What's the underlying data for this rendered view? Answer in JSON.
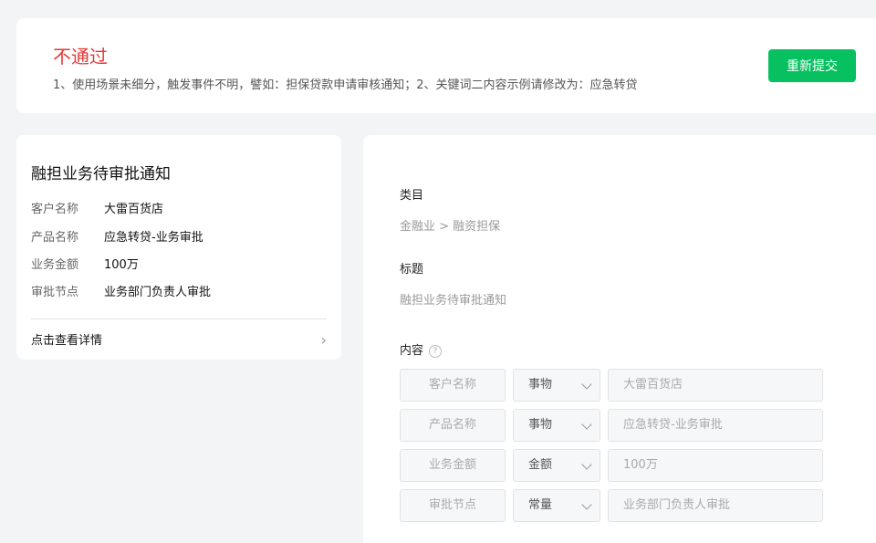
{
  "banner": {
    "status": "不通过",
    "message": "1、使用场景未细分，触发事件不明，譬如：担保贷款申请审核通知；2、关键词二内容示例请修改为：应急转贷",
    "resubmit_label": "重新提交"
  },
  "preview": {
    "title": "融担业务待审批通知",
    "fields": [
      {
        "label": "客户名称",
        "value": "大雷百货店"
      },
      {
        "label": "产品名称",
        "value": "应急转贷-业务审批"
      },
      {
        "label": "业务金额",
        "value": "100万"
      },
      {
        "label": "审批节点",
        "value": "业务部门负责人审批"
      }
    ],
    "detail_link": "点击查看详情"
  },
  "form": {
    "category_label": "类目",
    "category_value": "金融业 > 融资担保",
    "title_label": "标题",
    "title_value": "融担业务待审批通知",
    "content_label": "内容",
    "rows": [
      {
        "name": "客户名称",
        "type": "事物",
        "value": "大雷百货店"
      },
      {
        "name": "产品名称",
        "type": "事物",
        "value": "应急转贷-业务审批"
      },
      {
        "name": "业务金额",
        "type": "金额",
        "value": "100万"
      },
      {
        "name": "审批节点",
        "type": "常量",
        "value": "业务部门负责人审批"
      }
    ]
  },
  "colors": {
    "accent": "#07c160",
    "error": "#e53935"
  }
}
